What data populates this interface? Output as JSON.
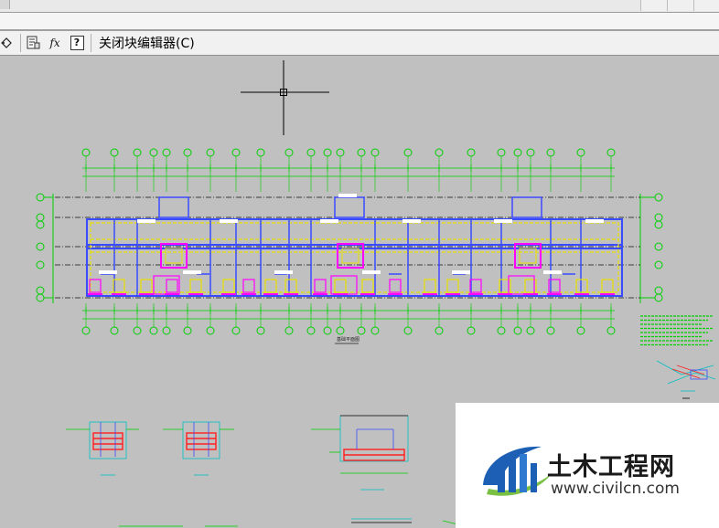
{
  "block_editor_toolbar": {
    "close_label": "关闭块编辑器(C)",
    "tools": [
      {
        "name": "parameter-tool-icon"
      },
      {
        "name": "attribute-definition-icon"
      },
      {
        "name": "fx-icon",
        "label": "fx"
      },
      {
        "name": "help-icon",
        "label": "?"
      }
    ]
  },
  "drawing": {
    "title_label": "基础平面图"
  },
  "watermark": {
    "title": "土木工程网",
    "url": "www.civilcn.com"
  },
  "colors": {
    "canvas_bg": "#c0c0c0",
    "grid_green": "#00d000",
    "wall_blue": "#3a4bff",
    "wall_yellow": "#e8e000",
    "column_magenta": "#ff00ff",
    "rebar_red": "#ff2020",
    "dim_cyan": "#00c0c0",
    "logo_blue": "#1d5fb4",
    "logo_green": "#7ac143"
  }
}
